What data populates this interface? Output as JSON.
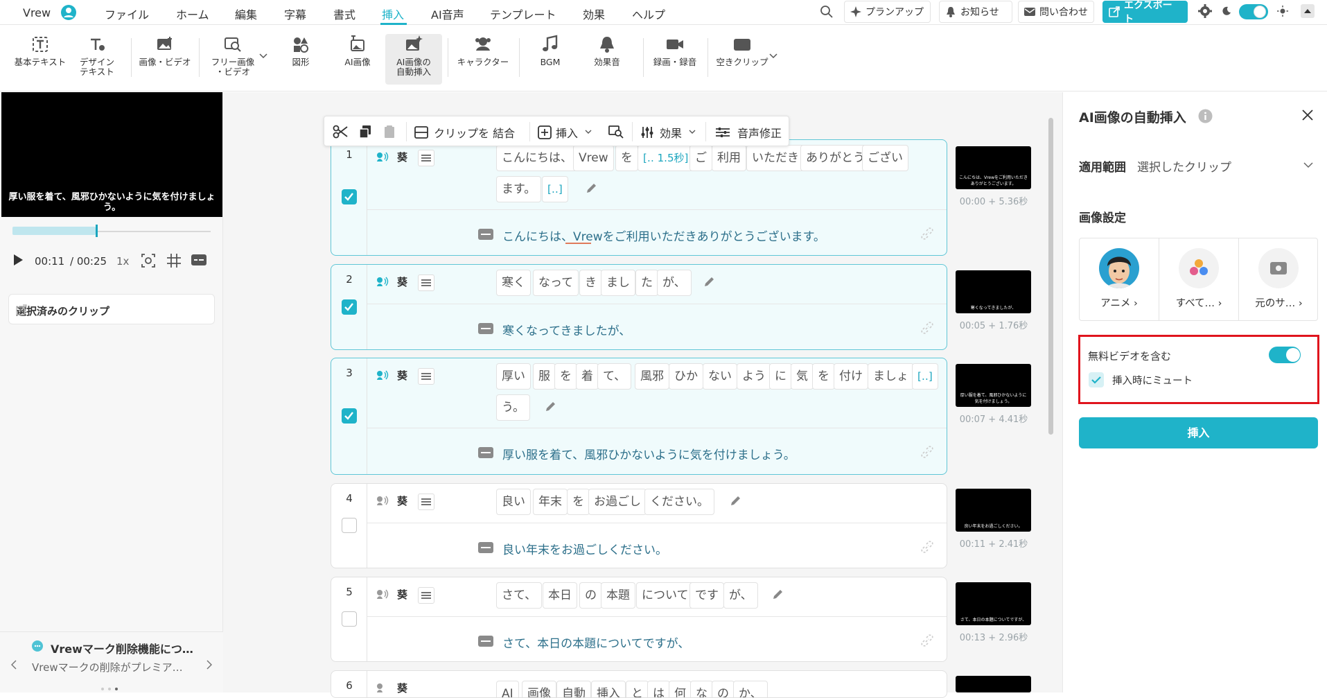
{
  "app": {
    "name": "Vrew"
  },
  "menu": [
    "ファイル",
    "ホーム",
    "編集",
    "字幕",
    "書式",
    "挿入",
    "AI音声",
    "テンプレート",
    "効果",
    "ヘルプ"
  ],
  "header": {
    "plan_up": "プランアップ",
    "notices": "お知らせ",
    "contact": "問い合わせ",
    "export": "エクスポート"
  },
  "toolbar": {
    "basic_text": "基本テキスト",
    "design_text_1": "デザイン",
    "design_text_2": "テキスト",
    "image_video": "画像・ビデオ",
    "free_image_1": "フリー画像",
    "free_image_2": "・ビデオ",
    "shapes": "図形",
    "ai_image": "AI画像",
    "ai_auto_1": "AI画像の",
    "ai_auto_2": "自動挿入",
    "character": "キャラクター",
    "bgm": "BGM",
    "sfx": "効果音",
    "record": "録画・録音",
    "empty_clip": "空きクリップ"
  },
  "preview": {
    "subtitle": "厚い服を着て、風邪ひかないように気を付けましょう。",
    "current": "00:11",
    "total": "/ 00:25",
    "speed": "1x",
    "progress": 0.42
  },
  "left": {
    "selected_clips": "選択済みのクリップ",
    "notice_title": "Vrewマーク削除機能につ…",
    "notice_body": "Vrewマークの削除がプレミア…"
  },
  "cliptoolbar": {
    "merge": "クリップを 結合",
    "insert": "挿入",
    "effects": "効果",
    "voice_fix": "音声修正"
  },
  "clips": [
    {
      "num": "1",
      "speaker": "葵",
      "selected": true,
      "words_row1": [
        "こんにちは、",
        "Vrew",
        "を",
        "[‥ 1.5秒]",
        "ご",
        "利用",
        "いただき",
        "ありがとう",
        "ござい"
      ],
      "words_row2": [
        "ます。",
        "[‥]"
      ],
      "sentence": "こんにちは、Vrewをご利用いただきありがとうございます。",
      "thumb": "こんにちは、Vrewをご利用いただきありがとうございます。",
      "timecode": "00:00 + 5.36秒"
    },
    {
      "num": "2",
      "speaker": "葵",
      "selected": true,
      "words_row1": [
        "寒く",
        "なって",
        "き",
        "まし",
        "た",
        "が、"
      ],
      "sentence": "寒くなってきましたが、",
      "thumb": "寒くなってきましたが、",
      "timecode": "00:05 + 1.76秒"
    },
    {
      "num": "3",
      "speaker": "葵",
      "selected": true,
      "words_row1": [
        "厚い",
        "服",
        "を",
        "着",
        "て、",
        "風邪",
        "ひか",
        "ない",
        "よう",
        "に",
        "気",
        "を",
        "付け",
        "ましょ",
        "[‥]"
      ],
      "words_row2": [
        "う。"
      ],
      "sentence": "厚い服を着て、風邪ひかないように気を付けましょう。",
      "thumb": "厚い服を着て、風邪ひかないように気を付けましょう。",
      "timecode": "00:07 + 4.41秒"
    },
    {
      "num": "4",
      "speaker": "葵",
      "selected": false,
      "words_row1": [
        "良い",
        "年末",
        "を",
        "お過ごし",
        "ください。"
      ],
      "sentence": "良い年末をお過ごしください。",
      "thumb": "良い年末をお過ごしください。",
      "timecode": "00:11 + 2.41秒"
    },
    {
      "num": "5",
      "speaker": "葵",
      "selected": false,
      "words_row1": [
        "さて、",
        "本日",
        "の",
        "本題",
        "について",
        "です",
        "が、"
      ],
      "sentence": "さて、本日の本題についてですが、",
      "thumb": "さて、本日の本題についてですが、",
      "timecode": "00:13 + 2.96秒"
    },
    {
      "num": "6",
      "speaker": "葵",
      "selected": false,
      "words_row1": [
        "AI",
        "画像",
        "自動",
        "挿入",
        "と",
        "は",
        "何",
        "な",
        "の",
        "か、"
      ]
    }
  ],
  "panel": {
    "title": "AI画像の自動挿入",
    "scope_label": "適用範囲",
    "scope_value": "選択したクリップ",
    "image_settings": "画像設定",
    "styles": [
      "アニメ",
      "すべて…",
      "元のサ…"
    ],
    "include_free_video": "無料ビデオを含む",
    "mute_on_insert": "挿入時にミュート",
    "insert_button": "挿入"
  },
  "colors": {
    "accent": "#1fb3c9",
    "highlight": "#e0141d"
  }
}
